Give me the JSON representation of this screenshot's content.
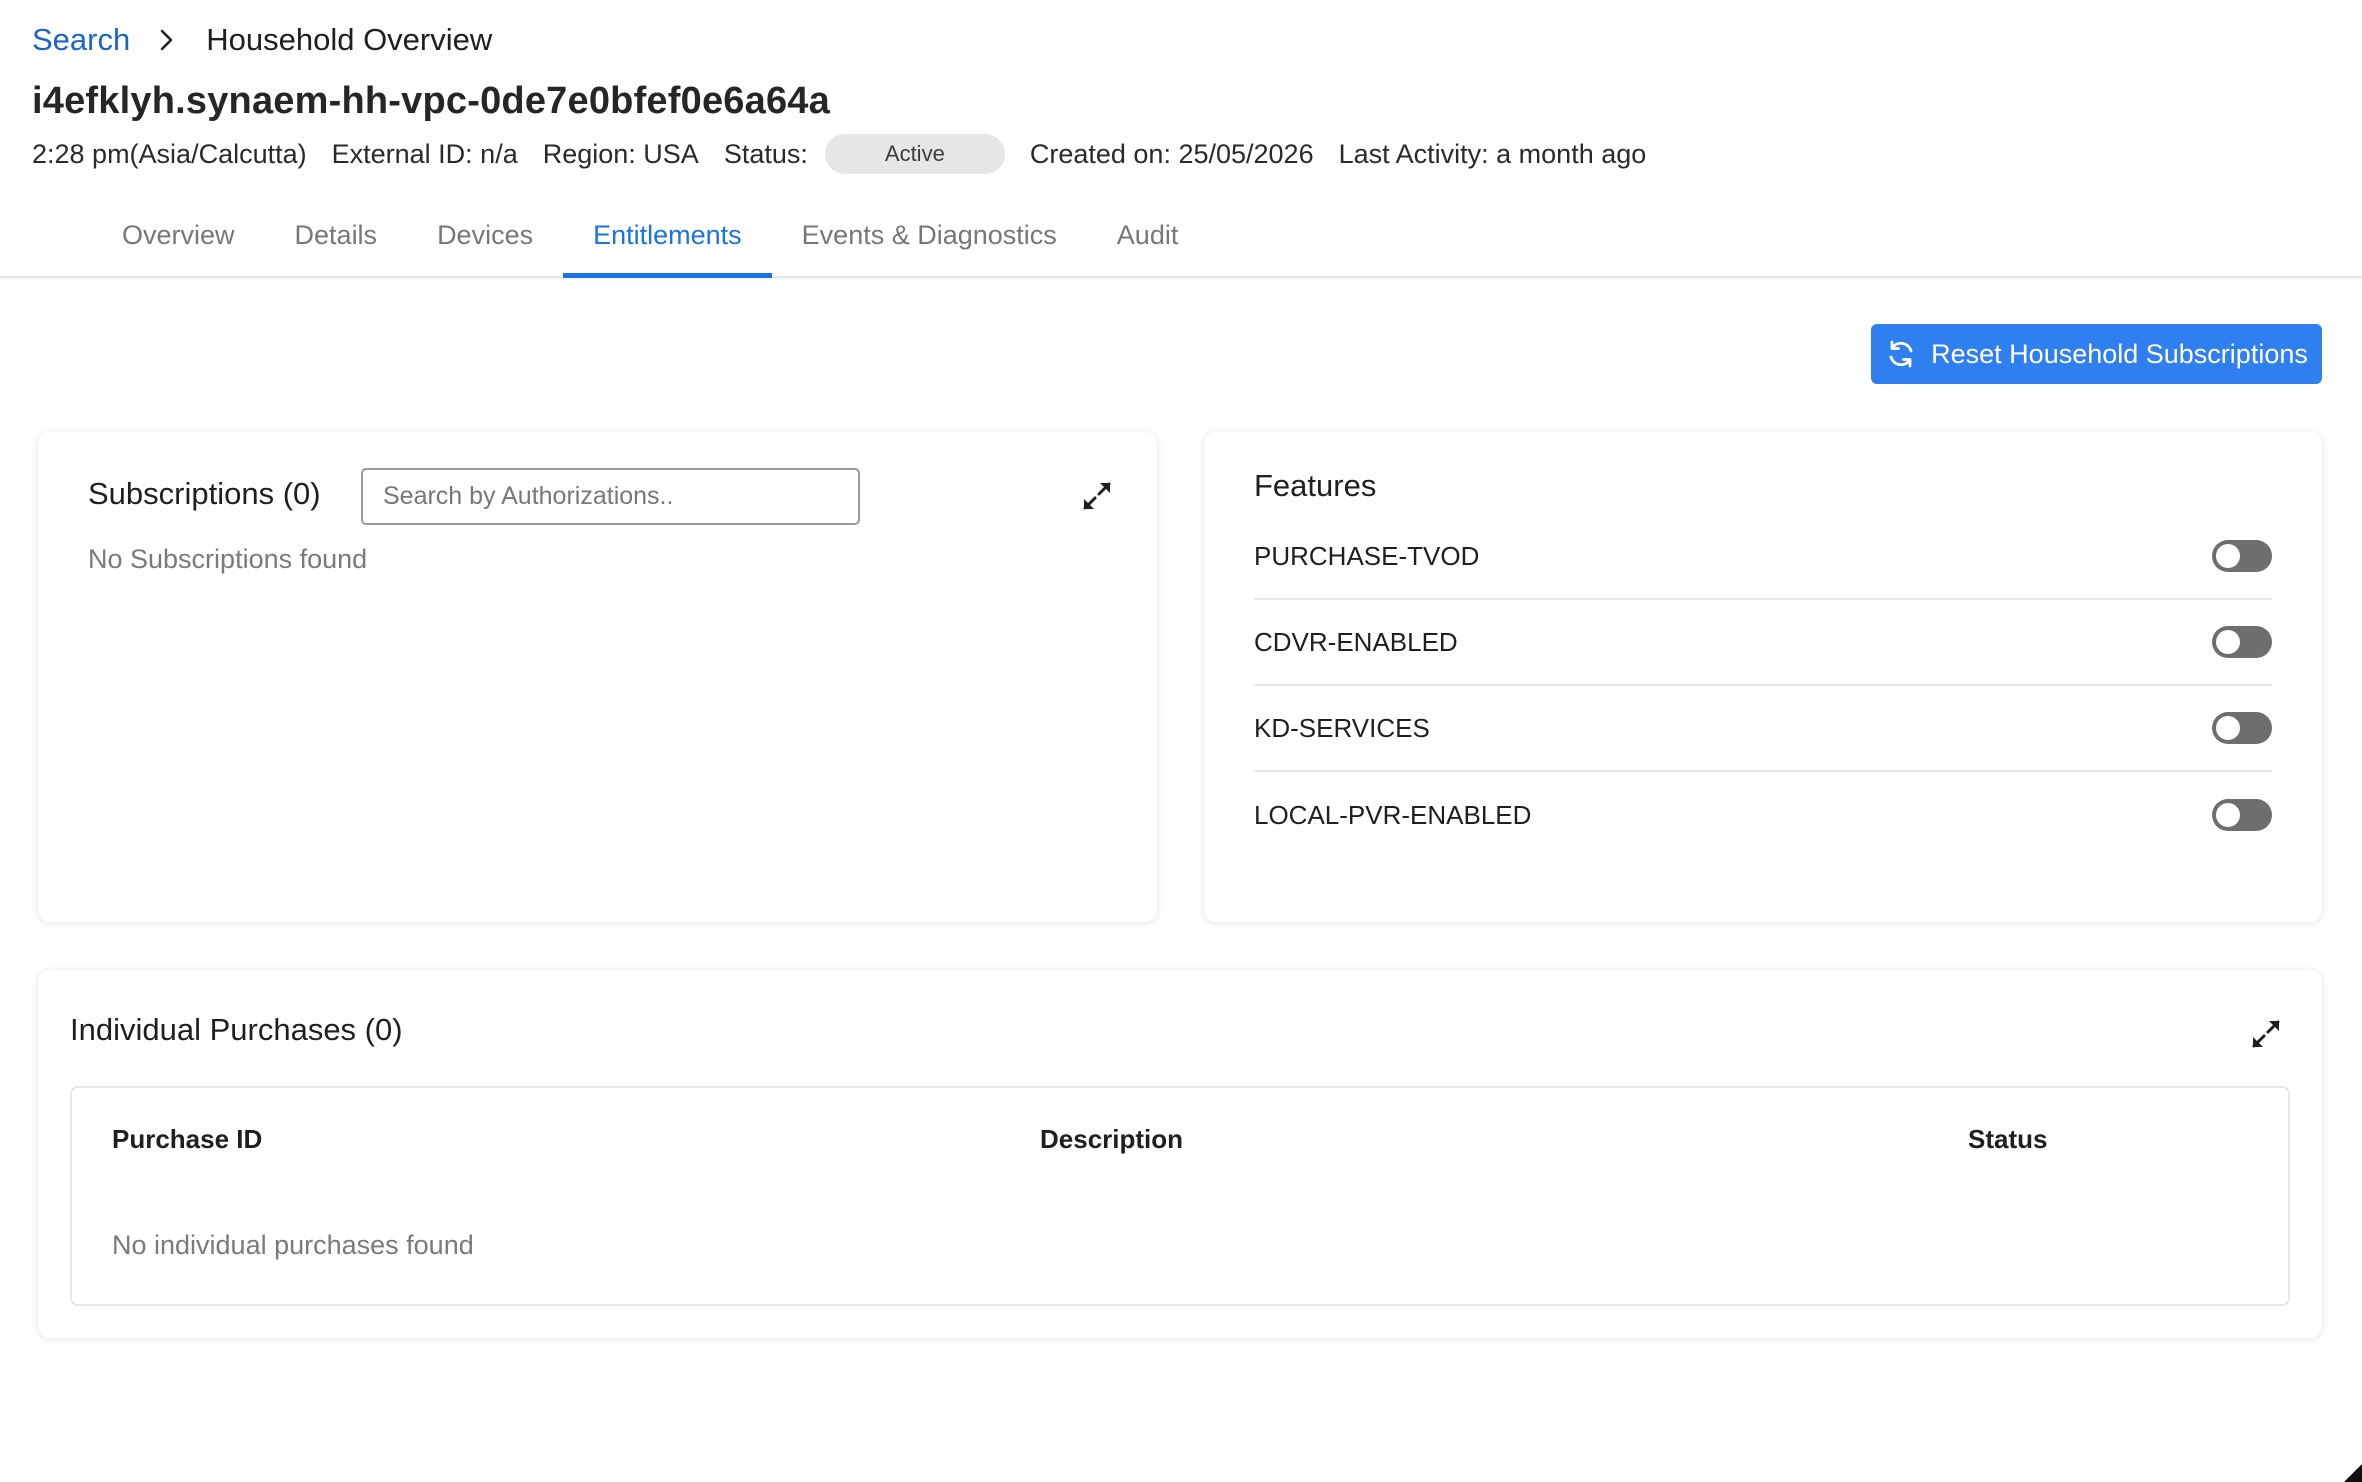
{
  "breadcrumb": {
    "link": "Search",
    "current": "Household Overview"
  },
  "household": {
    "id": "i4efklyh.synaem-hh-vpc-0de7e0bfef0e6a64a",
    "time": "2:28 pm(Asia/Calcutta)",
    "external_id": "External ID: n/a",
    "region": "Region: USA",
    "status_label": "Status:",
    "status": "Active",
    "created": "Created on: 25/05/2026",
    "last_activity": "Last Activity: a month ago"
  },
  "tabs": [
    {
      "label": "Overview",
      "active": false
    },
    {
      "label": "Details",
      "active": false
    },
    {
      "label": "Devices",
      "active": false
    },
    {
      "label": "Entitlements",
      "active": true
    },
    {
      "label": "Events & Diagnostics",
      "active": false
    },
    {
      "label": "Audit",
      "active": false
    }
  ],
  "actions": {
    "reset_label": "Reset Household Subscriptions",
    "reset_icon": "refresh-icon"
  },
  "subscriptions": {
    "title": "Subscriptions (0)",
    "search_placeholder": "Search by Authorizations..",
    "empty_text": "No Subscriptions found",
    "expand_icon": "expand-icon"
  },
  "features": {
    "title": "Features",
    "items": [
      {
        "label": "PURCHASE-TVOD",
        "enabled": false
      },
      {
        "label": "CDVR-ENABLED",
        "enabled": false
      },
      {
        "label": "KD-SERVICES",
        "enabled": false
      },
      {
        "label": "LOCAL-PVR-ENABLED",
        "enabled": false
      }
    ]
  },
  "purchases": {
    "title": "Individual Purchases (0)",
    "columns": [
      "Purchase ID",
      "Description",
      "Status"
    ],
    "empty_text": "No individual purchases found",
    "expand_icon": "expand-icon"
  },
  "colors": {
    "accent": "#1a73e8",
    "button": "#2f7ff0",
    "link": "#1a66c8",
    "toggle_off": "#6e6e6e",
    "status_pill": "#e6e6e6"
  }
}
